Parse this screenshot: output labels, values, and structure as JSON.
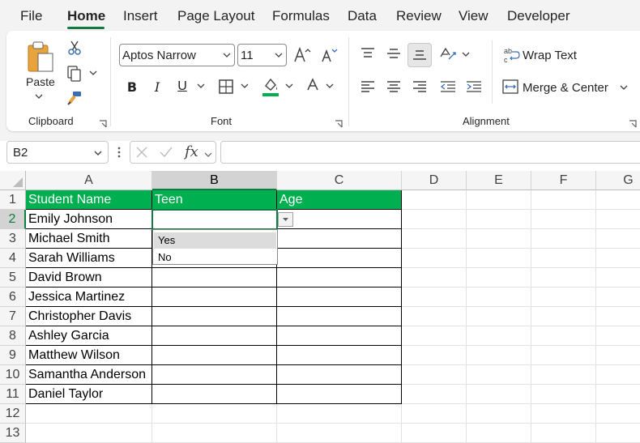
{
  "menu": {
    "tabs": [
      "File",
      "Home",
      "Insert",
      "Page Layout",
      "Formulas",
      "Data",
      "Review",
      "View",
      "Developer"
    ],
    "active": "Home"
  },
  "ribbon": {
    "clipboard": {
      "paste_label": "Paste",
      "group_label": "Clipboard"
    },
    "font": {
      "family": "Aptos Narrow",
      "size": "11",
      "group_label": "Font"
    },
    "alignment": {
      "wrap_text_label": "Wrap Text",
      "merge_center_label": "Merge & Center",
      "group_label": "Alignment"
    }
  },
  "formula_bar": {
    "name_box": "B2",
    "fx_label": "fx",
    "formula": ""
  },
  "grid": {
    "columns": [
      "A",
      "B",
      "C",
      "D",
      "E",
      "F",
      "G"
    ],
    "rows": [
      "1",
      "2",
      "3",
      "4",
      "5",
      "6",
      "7",
      "8",
      "9",
      "10",
      "11",
      "12",
      "13"
    ],
    "headers": [
      "Student Name",
      "Teen",
      "Age"
    ],
    "students": [
      "Emily Johnson",
      "Michael Smith",
      "Sarah Williams",
      "David Brown",
      "Jessica Martinez",
      "Christopher Davis",
      "Ashley Garcia",
      "Matthew Wilson",
      "Samantha Anderson",
      "Daniel Taylor"
    ],
    "dropdown_options": [
      "Yes",
      "No"
    ]
  },
  "colors": {
    "accent": "#107c41",
    "header_fill": "#00b050",
    "header_text": "#ffffff"
  }
}
